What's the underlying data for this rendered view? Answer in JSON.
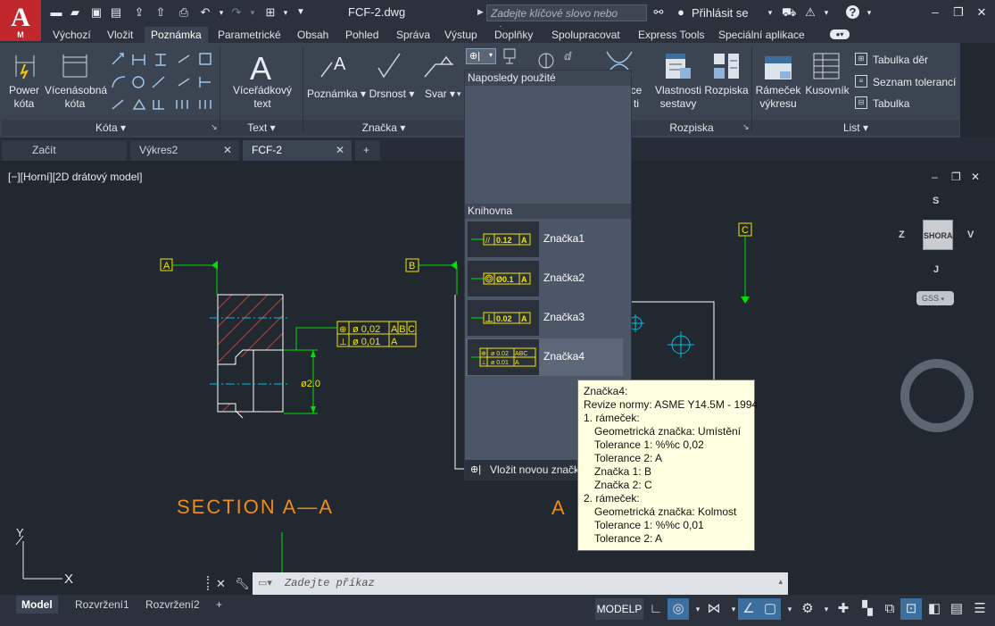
{
  "app": {
    "logo_letter": "A",
    "logo_sub": "M",
    "doc_title": "FCF-2.dwg"
  },
  "titlebar": {
    "search_placeholder": "Zadejte klíčové slovo nebo výraz.",
    "sign_in": "Přihlásit se",
    "help": "?"
  },
  "menu_tabs": [
    "Výchozí",
    "Vložit",
    "Poznámka",
    "Parametrické",
    "Obsah",
    "Pohled",
    "Správa",
    "Výstup",
    "Doplňky",
    "Spolupracovat",
    "Express Tools",
    "Speciální aplikace"
  ],
  "active_menu_tab": "Poznámka",
  "ribbon": {
    "power_kota": "Power\nkóta",
    "vicenasobna": "Vícenásobná\nkóta",
    "kota_title": "Kóta",
    "text_button": "Víceřádkový\ntext",
    "text_title": "Text",
    "poznamka": "Poznámka",
    "drsnost": "Drsnost",
    "svar": "Svar",
    "znacka_title": "Značka",
    "vazba_partial": "ce",
    "vazba_partial2": "ti",
    "vlastnosti": "Vlastnosti\nsestavy",
    "rozpiska": "Rozpiska",
    "rozpiska_title": "Rozpiska",
    "ramecek": "Rámeček\nvýkresu",
    "kusovnik": "Kusovník",
    "tabulka_der": "Tabulka děr",
    "seznam_toleranci": "Seznam tolerancí",
    "tabulka": "Tabulka",
    "list_title": "List"
  },
  "doc_tabs": [
    {
      "label": "Začít",
      "closable": false
    },
    {
      "label": "Výkres2",
      "closable": true
    },
    {
      "label": "FCF-2",
      "closable": true
    }
  ],
  "viewport": {
    "label": "[−][Horní][2D drátový model]"
  },
  "dropdown": {
    "recent_header": "Naposledy použité",
    "library_header": "Knihovna",
    "items": [
      {
        "name": "Značka1",
        "thumb": "0.12|A"
      },
      {
        "name": "Značka2",
        "thumb": "Ø0.1|A"
      },
      {
        "name": "Značka3",
        "thumb": "0.02|A"
      },
      {
        "name": "Značka4",
        "thumb": "0.02ABC|0.01A"
      }
    ],
    "insert_new": "Vložit novou značku"
  },
  "tooltip": {
    "lines": [
      {
        "text": "Značka4:",
        "indent": false
      },
      {
        "text": "Revize normy: ASME Y14.5M - 1994",
        "indent": false
      },
      {
        "text": "1. rámeček:",
        "indent": false
      },
      {
        "text": "Geometrická značka: Umístění",
        "indent": true
      },
      {
        "text": "Tolerance 1: %%c 0,02",
        "indent": true
      },
      {
        "text": "Tolerance 2: A",
        "indent": true
      },
      {
        "text": "Značka 1: B",
        "indent": true
      },
      {
        "text": "Značka 2: C",
        "indent": true
      },
      {
        "text": "2. rámeček:",
        "indent": false
      },
      {
        "text": "Geometrická značka: Kolmost",
        "indent": true
      },
      {
        "text": "Tolerance 1: %%c 0,01",
        "indent": true
      },
      {
        "text": "Tolerance 2: A",
        "indent": true
      }
    ]
  },
  "drawing": {
    "datum_a": "A",
    "datum_b": "B",
    "datum_c": "C",
    "section_label": "SECTION A—A",
    "dimension": "ø2.0",
    "fcf_row1_tol": "ø 0,02",
    "fcf_row1_data": "A B C",
    "fcf_row2_tol": "ø 0,01",
    "fcf_row2_data": "A",
    "partial_a": "A"
  },
  "viewcube": {
    "top": "SHORA",
    "n": "S",
    "s": "J",
    "w": "Z",
    "e": "V",
    "wcs": "GSS"
  },
  "axes": {
    "x": "X",
    "y": "Y"
  },
  "command": {
    "placeholder": "Zadejte příkaz"
  },
  "layouts": [
    "Model",
    "Rozvržení1",
    "Rozvržení2"
  ],
  "status": {
    "modelp": "MODELP"
  },
  "colors": {
    "accent": "#c1272d",
    "drawing_yellow": "#f2e600",
    "drawing_green": "#00e000",
    "section_orange": "#f08a1a",
    "hatch_red": "#e03030"
  }
}
